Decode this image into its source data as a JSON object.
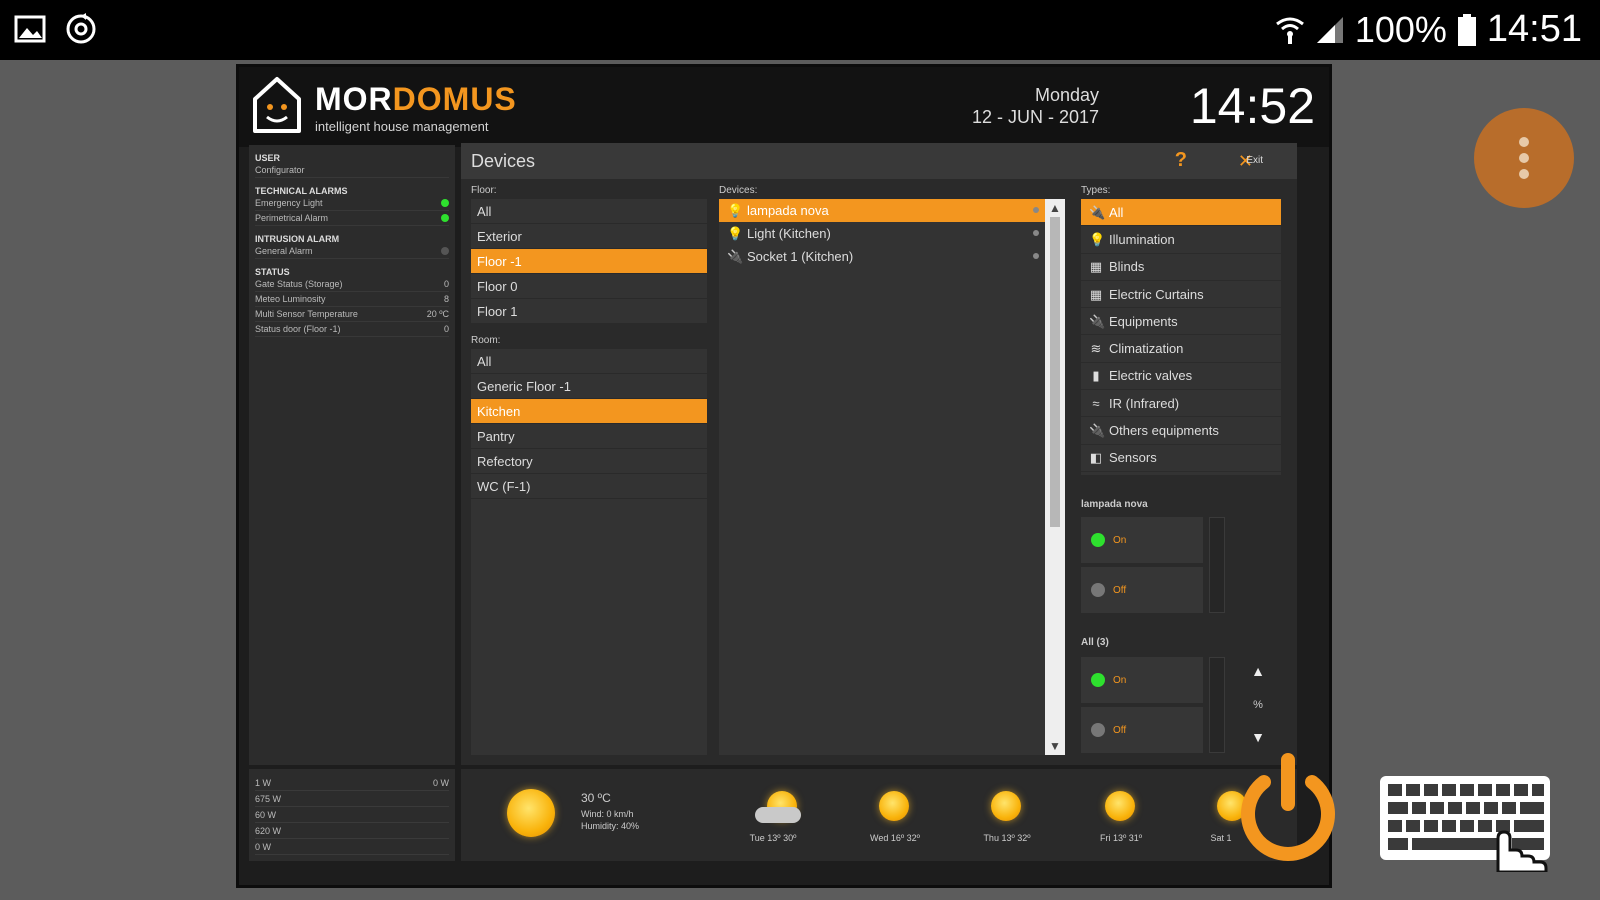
{
  "statusbar": {
    "battery": "100%",
    "time": "14:51",
    "icons": [
      "gallery-icon",
      "sync-icon",
      "wifi-icon",
      "signal-icon",
      "battery-icon"
    ]
  },
  "app": {
    "brand_part1": "MOR",
    "brand_part2": "DOMUS",
    "tagline": "intelligent house management",
    "day": "Monday",
    "date": "12 - JUN - 2017",
    "clock": "14:52"
  },
  "sidebar": {
    "user_head": "USER",
    "user_value": "Configurator",
    "tech_head": "TECHNICAL ALARMS",
    "tech_items": [
      "Emergency Light",
      "Perimetrical Alarm"
    ],
    "intrusion_head": "INTRUSION ALARM",
    "intrusion_items": [
      "General Alarm"
    ],
    "status_head": "STATUS",
    "status_items": [
      {
        "label": "Gate Status (Storage)",
        "value": "0"
      },
      {
        "label": "Meteo Luminosity",
        "value": "8"
      },
      {
        "label": "Multi Sensor Temperature",
        "value": "20 ºC"
      },
      {
        "label": "Status door (Floor -1)",
        "value": "0"
      }
    ]
  },
  "power": {
    "rows": [
      {
        "label": "1 W",
        "value": "0 W"
      },
      {
        "label": "675 W",
        "value": ""
      },
      {
        "label": "60 W",
        "value": ""
      },
      {
        "label": "620 W",
        "value": ""
      },
      {
        "label": "0 W",
        "value": ""
      }
    ]
  },
  "devices_panel": {
    "title": "Devices",
    "help": "?",
    "exit_label": "Exit",
    "floor_label": "Floor:",
    "floors": [
      "All",
      "Exterior",
      "Floor -1",
      "Floor 0",
      "Floor 1"
    ],
    "floor_selected": 2,
    "room_label": "Room:",
    "rooms": [
      "All",
      "Generic Floor -1",
      "Kitchen",
      "Pantry",
      "Refectory",
      "WC (F-1)"
    ],
    "room_selected": 2,
    "devices_label": "Devices:",
    "devices": [
      "lampada nova",
      "Light (Kitchen)",
      "Socket 1 (Kitchen)"
    ],
    "device_selected": 0,
    "types_label": "Types:",
    "types": [
      "All",
      "Illumination",
      "Blinds",
      "Electric Curtains",
      "Equipments",
      "Climatization",
      "Electric valves",
      "IR (Infrared)",
      "Others equipments",
      "Sensors"
    ],
    "type_selected": 0,
    "control1_label": "lampada nova",
    "control2_label": "All (3)",
    "on_label": "On",
    "off_label": "Off",
    "percent": "%"
  },
  "weather": {
    "today_temp": "30 ºC",
    "today_wind": "Wind: 0 km/h",
    "today_humidity": "Humidity: 40%",
    "forecast": [
      {
        "day": "Tue 13º 30º"
      },
      {
        "day": "Wed 16º 32º"
      },
      {
        "day": "Thu 13º 32º"
      },
      {
        "day": "Fri 13º 31º"
      },
      {
        "day": "Sat 1"
      }
    ]
  },
  "colors": {
    "accent": "#f3961f",
    "on_green": "#2ee02e",
    "fab": "#b86d2b"
  }
}
